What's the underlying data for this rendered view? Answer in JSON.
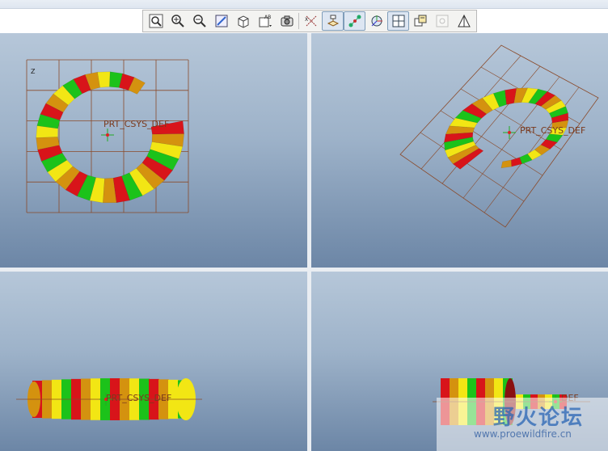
{
  "toolbar": {
    "buttons": [
      {
        "name": "refit-icon",
        "active": false,
        "disabled": false
      },
      {
        "name": "zoom-in-icon",
        "active": false,
        "disabled": false
      },
      {
        "name": "zoom-out-icon",
        "active": false,
        "disabled": false
      },
      {
        "name": "repaint-icon",
        "active": false,
        "disabled": false
      },
      {
        "name": "orient-icon",
        "active": false,
        "disabled": false
      },
      {
        "name": "saved-views-icon",
        "active": false,
        "disabled": false
      },
      {
        "name": "display-style-icon",
        "active": false,
        "disabled": false
      },
      {
        "name": "datum-axes-icon",
        "active": false,
        "disabled": false
      },
      {
        "name": "datum-planes-icon",
        "active": true,
        "disabled": false
      },
      {
        "name": "datum-points-icon",
        "active": true,
        "disabled": false
      },
      {
        "name": "csys-icon",
        "active": false,
        "disabled": false
      },
      {
        "name": "layout-icon",
        "active": true,
        "disabled": false
      },
      {
        "name": "annotations-icon",
        "active": false,
        "disabled": false
      },
      {
        "name": "spin-center-icon",
        "active": false,
        "disabled": true
      },
      {
        "name": "perspective-icon",
        "active": false,
        "disabled": false
      }
    ]
  },
  "viewports": {
    "top_left": {
      "csys_label": "PRT_CSYS_DEF",
      "axis_label": "Z"
    },
    "top_right": {
      "csys_label": "PRT_CSYS_DEF"
    },
    "bottom_left": {
      "csys_label": "PRT_CSYS_DEF"
    },
    "bottom_right": {
      "csys_label": "DEF"
    }
  },
  "colors": {
    "band_red": "#d8141a",
    "band_green": "#1cc21a",
    "band_yellow": "#f2e614",
    "band_orange": "#d4920f",
    "grid_lines": "#8a4a2a",
    "background_top": "#b6c7d9",
    "background_bottom": "#6c86a6"
  },
  "watermark": {
    "title": "野火论坛",
    "url": "www.proewildfire.cn"
  }
}
